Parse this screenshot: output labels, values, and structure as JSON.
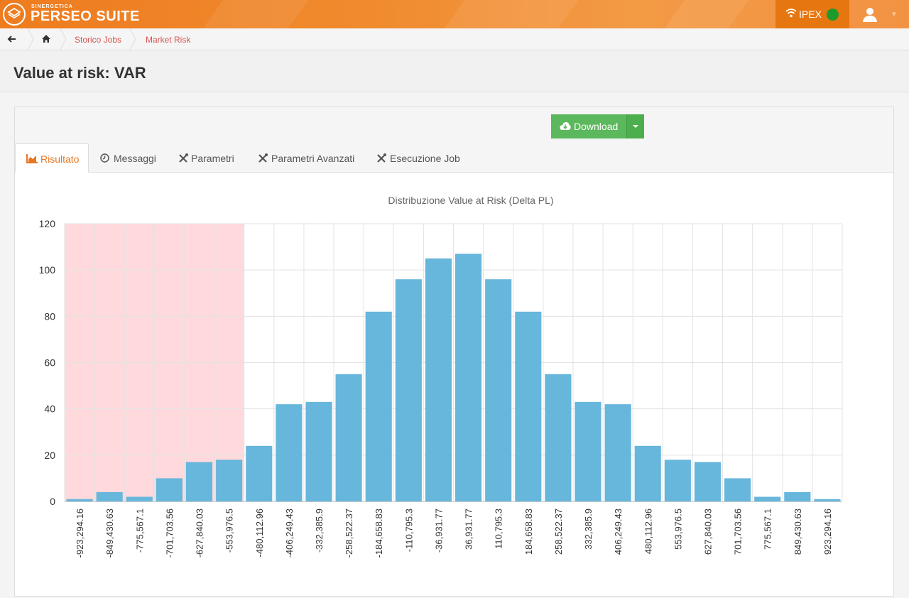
{
  "app": {
    "brand_small": "SINERGETICA",
    "brand": "PERSEO SUITE"
  },
  "topbar": {
    "connection_label": "IPEX",
    "status_color": "#1d9a2c",
    "accent": "#ee7c1f"
  },
  "breadcrumb": {
    "items": [
      "Storico Jobs",
      "Market Risk"
    ]
  },
  "page": {
    "title": "Value at risk: VAR"
  },
  "toolbar": {
    "download_label": "Download"
  },
  "tabs": [
    {
      "label": "Risultato",
      "icon": "area-chart-icon",
      "active": true
    },
    {
      "label": "Messaggi",
      "icon": "clock-icon",
      "active": false
    },
    {
      "label": "Parametri",
      "icon": "tools-icon",
      "active": false
    },
    {
      "label": "Parametri Avanzati",
      "icon": "tools-icon",
      "active": false
    },
    {
      "label": "Esecuzione Job",
      "icon": "tools-icon",
      "active": false
    }
  ],
  "chart_data": {
    "type": "bar",
    "title": "Distribuzione Value at Risk (Delta PL)",
    "xlabel": "",
    "ylabel": "",
    "ylim": [
      0,
      120
    ],
    "yticks": [
      0,
      20,
      40,
      60,
      80,
      100,
      120
    ],
    "grid": true,
    "bar_color": "#67b6dc",
    "highlight_color": "#ffd9dc",
    "highlight_range": [
      "-923,294.16",
      "-553,976.5"
    ],
    "categories": [
      "-923,294.16",
      "-849,430.63",
      "-775,567.1",
      "-701,703.56",
      "-627,840.03",
      "-553,976.5",
      "-480,112.96",
      "-406,249.43",
      "-332,385.9",
      "-258,522.37",
      "-184,658.83",
      "-110,795.3",
      "-36,931.77",
      "36,931.77",
      "110,795.3",
      "184,658.83",
      "258,522.37",
      "332,385.9",
      "406,249.43",
      "480,112.96",
      "553,976.5",
      "627,840.03",
      "701,703.56",
      "775,567.1",
      "849,430.63",
      "923,294.16"
    ],
    "values": [
      1,
      4,
      2,
      10,
      17,
      18,
      24,
      42,
      43,
      55,
      82,
      96,
      105,
      107,
      96,
      82,
      55,
      43,
      42,
      24,
      18,
      17,
      10,
      2,
      4,
      1
    ]
  }
}
